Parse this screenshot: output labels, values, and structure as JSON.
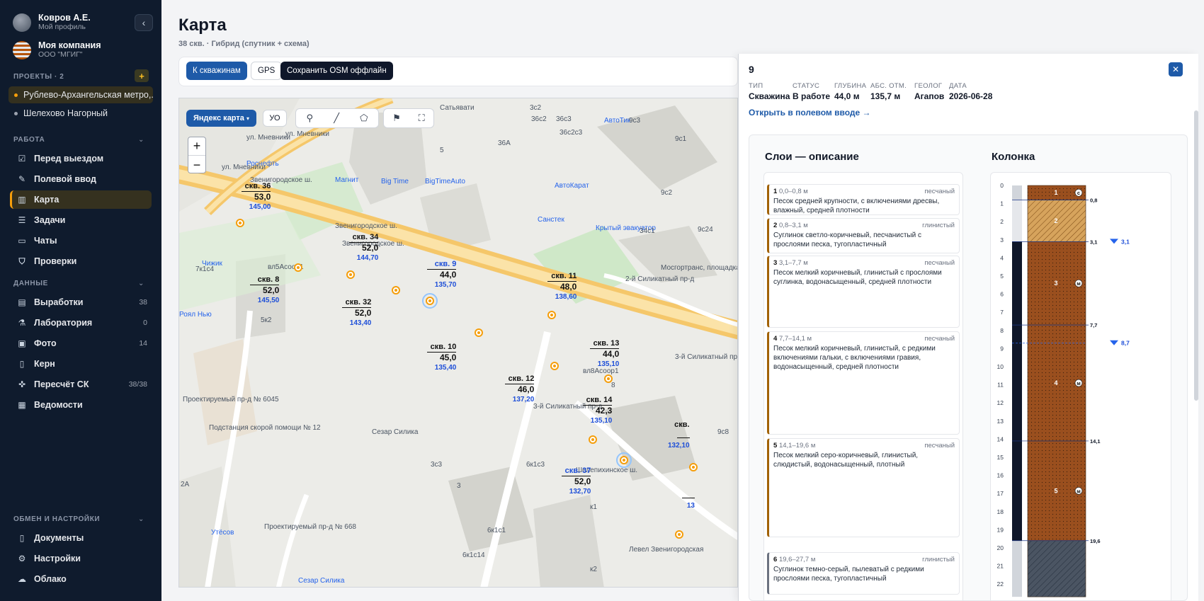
{
  "user": {
    "name": "Ковров А.Е.",
    "sub": "Мой профиль"
  },
  "company": {
    "name": "Моя компания",
    "sub": "ООО \"МГИГ\""
  },
  "projects": {
    "title": "ПРОЕКТЫ · 2",
    "items": [
      {
        "label": "Рублево-Архангельская метро,...",
        "color": "#f59e0b"
      },
      {
        "label": "Шелехово Нагорный",
        "color": "#9ca3af"
      }
    ]
  },
  "work": {
    "title": "РАБОТА",
    "items": [
      {
        "label": "Перед выездом",
        "icon": "checklist-icon",
        "glyph": "☑"
      },
      {
        "label": "Полевой ввод",
        "icon": "pencil-icon",
        "glyph": "✎"
      },
      {
        "label": "Карта",
        "icon": "map-icon",
        "glyph": "▥"
      },
      {
        "label": "Задачи",
        "icon": "tasks-icon",
        "glyph": "☰"
      },
      {
        "label": "Чаты",
        "icon": "chat-icon",
        "glyph": "▭"
      },
      {
        "label": "Проверки",
        "icon": "shield-check-icon",
        "glyph": "⛉"
      }
    ]
  },
  "data_section": {
    "title": "ДАННЫЕ",
    "items": [
      {
        "label": "Выработки",
        "count": "38",
        "icon": "database-icon",
        "glyph": "▤"
      },
      {
        "label": "Лаборатория",
        "count": "0",
        "icon": "flask-icon",
        "glyph": "⚗"
      },
      {
        "label": "Фото",
        "count": "14",
        "icon": "image-icon",
        "glyph": "▣"
      },
      {
        "label": "Керн",
        "count": "",
        "icon": "file-icon",
        "glyph": "▯"
      },
      {
        "label": "Пересчёт СК",
        "count": "38/38",
        "icon": "crosshair-icon",
        "glyph": "✜"
      },
      {
        "label": "Ведомости",
        "count": "",
        "icon": "table-icon",
        "glyph": "▦"
      }
    ]
  },
  "settings_section": {
    "title": "ОБМЕН И НАСТРОЙКИ",
    "items": [
      {
        "label": "Документы",
        "icon": "document-icon",
        "glyph": "▯"
      },
      {
        "label": "Настройки",
        "icon": "gear-icon",
        "glyph": "⚙"
      },
      {
        "label": "Облако",
        "icon": "cloud-icon",
        "glyph": "☁"
      }
    ]
  },
  "page": {
    "title": "Карта",
    "subtitle": "38 скв. · Гибрид (спутник + схема)"
  },
  "toolbar": {
    "to_wells": "К скважинам",
    "gps": "GPS",
    "save_osm": "Сохранить OSM оффлайн"
  },
  "map": {
    "type_label": "Яндекс карта",
    "uo_label": "УО",
    "zoom_in": "+",
    "zoom_out": "−",
    "labels": [
      "Сатьявати",
      "ул. Мневники",
      "ул. Мневники",
      "ул. Мневники",
      "Роснефть",
      "Магнит",
      "Big Time",
      "BigTimeAuto",
      "АвтоТик",
      "АвтоКарат",
      "Санстек",
      "Крытый эвакуатор",
      "Звенигородское ш.",
      "Звенигородское ш.",
      "Звенигородское ш.",
      "Мосгортранс, площадка Мневники",
      "2-й Силикатный пр-д",
      "3-й Силикатный пр",
      "Чижик",
      "Роял Нью",
      "Проектируемый пр-д № 6045",
      "Подстанция скорой помощи № 12",
      "Сезар Силика",
      "3-й Силикатный пр-д",
      "Шелепихинское ш.",
      "Левел Звенигородская",
      "Утёсов",
      "Сезар Силика",
      "Проектируемый пр-д № 668",
      "9с1",
      "9с2",
      "34с1",
      "36с2",
      "36с3",
      "36с2с3",
      "36А",
      "9с3",
      "9с24",
      "9с8",
      "вл5Асоор1",
      "вл8Асоор1",
      "7к1с4",
      "5к2",
      "2А",
      "3с3",
      "6к1с3",
      "6к1с1",
      "6к1с14",
      "к1",
      "к2",
      "3",
      "5",
      "8",
      "3с2"
    ],
    "wells": [
      {
        "name": "скв. 36",
        "depth": "53,0",
        "abs": "145,00"
      },
      {
        "name": "скв. 34",
        "depth": "52,0",
        "abs": "144,70"
      },
      {
        "name": "скв. 9",
        "depth": "44,0",
        "abs": "135,70"
      },
      {
        "name": "скв. 11",
        "depth": "48,0",
        "abs": "138,60"
      },
      {
        "name": "скв. 8",
        "depth": "52,0",
        "abs": "145,50"
      },
      {
        "name": "скв. 32",
        "depth": "52,0",
        "abs": "143,40"
      },
      {
        "name": "скв. 10",
        "depth": "45,0",
        "abs": "135,40"
      },
      {
        "name": "скв. 13",
        "depth": "44,0",
        "abs": "135,10"
      },
      {
        "name": "скв. 12",
        "depth": "46,0",
        "abs": "137,20"
      },
      {
        "name": "скв. 14",
        "depth": "42,3",
        "abs": "135,10"
      },
      {
        "name": "скв. 37",
        "depth": "52,0",
        "abs": "132,70"
      },
      {
        "name": "скв.",
        "depth": "",
        "abs": "132,10"
      },
      {
        "name": "",
        "depth": "",
        "abs": "13"
      }
    ]
  },
  "panel": {
    "title": "9",
    "meta": [
      {
        "key": "ТИП",
        "value": "Скважина"
      },
      {
        "key": "СТАТУС",
        "value": "В работе"
      },
      {
        "key": "ГЛУБИНА",
        "value": "44,0 м"
      },
      {
        "key": "АБС. ОТМ.",
        "value": "135,7 м"
      },
      {
        "key": "ГЕОЛОГ",
        "value": "Агапов"
      },
      {
        "key": "ДАТА",
        "value": "2026-06-28"
      }
    ],
    "open_link": "Открыть в полевом вводе →",
    "layers_title": "Слои — описание",
    "column_title": "Колонка",
    "layers": [
      {
        "num": "1",
        "range": "0,0–0,8 м",
        "type": "песчаный",
        "desc": "Песок средней крупности, с включениями дресвы, влажный, средней плотности",
        "from": 0,
        "to": 0.8,
        "color": "#a16207"
      },
      {
        "num": "2",
        "range": "0,8–3,1 м",
        "type": "глинистый",
        "desc": "Суглинок светло-коричневый, песчанистый с прослоями песка, тугопластичный",
        "from": 0.8,
        "to": 3.1,
        "color": "#d6a35c"
      },
      {
        "num": "3",
        "range": "3,1–7,7 м",
        "type": "песчаный",
        "desc": "Песок мелкий коричневый, глинистый с прослоями суглинка, водонасыщенный, средней плотности",
        "from": 3.1,
        "to": 7.7,
        "color": "#9a4f1e"
      },
      {
        "num": "4",
        "range": "7,7–14,1 м",
        "type": "песчаный",
        "desc": "Песок мелкий коричневый, глинистый, с редкими включениями гальки, с включениями гравия, водонасыщенный, средней плотности",
        "from": 7.7,
        "to": 14.1,
        "color": "#9a4f1e"
      },
      {
        "num": "5",
        "range": "14,1–19,6 м",
        "type": "песчаный",
        "desc": "Песок мелкий серо-коричневый, глинистый, слюдистый, водонасыщенный, плотный",
        "from": 14.1,
        "to": 19.6,
        "color": "#9a4f1e"
      },
      {
        "num": "6",
        "range": "19,6–27,7 м",
        "type": "глинистый",
        "desc": "Суглинок темно-серый, пылеватый с редкими прослоями песка, тугопластичный",
        "from": 19.6,
        "to": 27.7,
        "color": "#4b5563"
      }
    ],
    "column": {
      "depth_ticks": [
        "0",
        "1",
        "2",
        "3",
        "4",
        "5",
        "6",
        "7",
        "8",
        "9",
        "10",
        "11",
        "12",
        "13",
        "14",
        "15",
        "16",
        "17",
        "18",
        "19",
        "20",
        "21",
        "22"
      ],
      "boundaries": [
        "0,8",
        "3,1",
        "7,7",
        "14,1",
        "19,6"
      ],
      "water_levels": [
        "3,1",
        "8,7"
      ],
      "layer_badges": [
        "1",
        "2",
        "3",
        "4",
        "5"
      ],
      "lithology_badges": [
        "с",
        "м",
        "м",
        "м"
      ]
    }
  }
}
